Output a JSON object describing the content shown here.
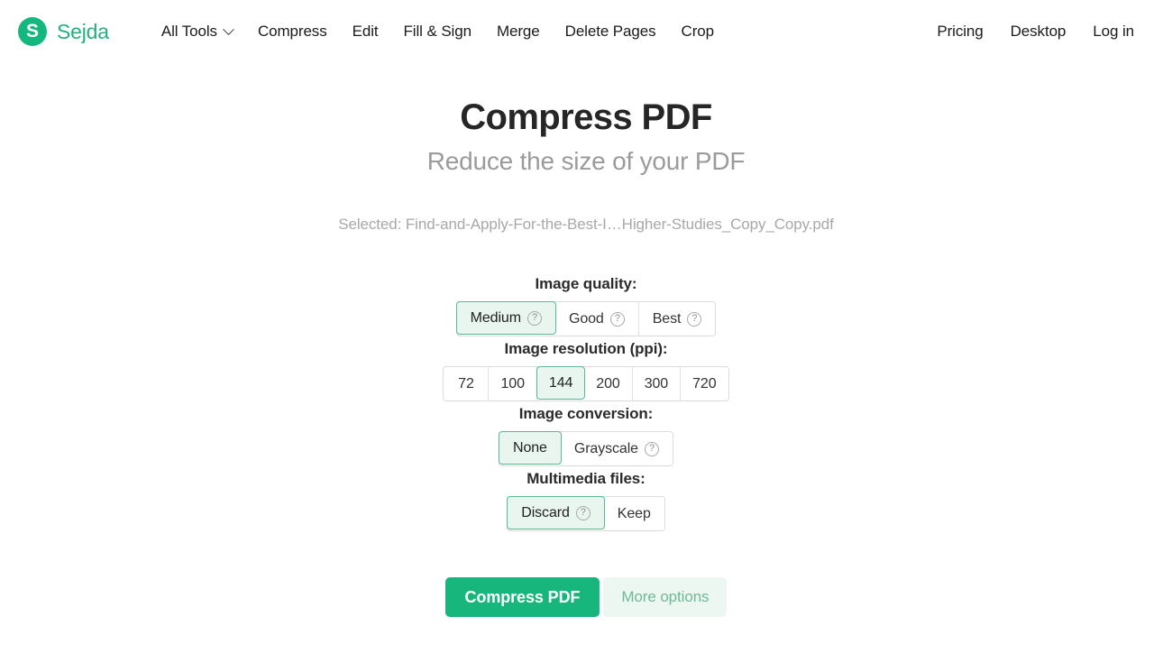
{
  "brand": {
    "mark_letter": "S",
    "name": "Sejda"
  },
  "nav": {
    "left": [
      {
        "label": "All Tools",
        "has_caret": true
      },
      {
        "label": "Compress",
        "has_caret": false
      },
      {
        "label": "Edit",
        "has_caret": false
      },
      {
        "label": "Fill & Sign",
        "has_caret": false
      },
      {
        "label": "Merge",
        "has_caret": false
      },
      {
        "label": "Delete Pages",
        "has_caret": false
      },
      {
        "label": "Crop",
        "has_caret": false
      }
    ],
    "right": [
      {
        "label": "Pricing"
      },
      {
        "label": "Desktop"
      },
      {
        "label": "Log in"
      }
    ]
  },
  "main": {
    "title": "Compress PDF",
    "subtitle": "Reduce the size of your PDF",
    "selected_file": "Selected: Find-and-Apply-For-the-Best-I…Higher-Studies_Copy_Copy.pdf"
  },
  "options": [
    {
      "key": "image_quality",
      "label": "Image quality:",
      "choices": [
        {
          "label": "Medium",
          "selected": true,
          "help": true
        },
        {
          "label": "Good",
          "selected": false,
          "help": true
        },
        {
          "label": "Best",
          "selected": false,
          "help": true
        }
      ]
    },
    {
      "key": "image_resolution",
      "label": "Image resolution (ppi):",
      "choices": [
        {
          "label": "72",
          "selected": false,
          "help": false
        },
        {
          "label": "100",
          "selected": false,
          "help": false
        },
        {
          "label": "144",
          "selected": true,
          "help": false
        },
        {
          "label": "200",
          "selected": false,
          "help": false
        },
        {
          "label": "300",
          "selected": false,
          "help": false
        },
        {
          "label": "720",
          "selected": false,
          "help": false
        }
      ]
    },
    {
      "key": "image_conversion",
      "label": "Image conversion:",
      "choices": [
        {
          "label": "None",
          "selected": true,
          "help": false
        },
        {
          "label": "Grayscale",
          "selected": false,
          "help": true
        }
      ]
    },
    {
      "key": "multimedia_files",
      "label": "Multimedia files:",
      "choices": [
        {
          "label": "Discard",
          "selected": true,
          "help": true
        },
        {
          "label": "Keep",
          "selected": false,
          "help": false
        }
      ]
    }
  ],
  "actions": {
    "primary_label": "Compress PDF",
    "secondary_label": "More options"
  },
  "icons": {
    "help": "?",
    "chevron_down": "chevron-down-icon"
  },
  "colors": {
    "brand_green": "#14b87e",
    "primary_button": "#17b67d",
    "selected_border": "#5cb894",
    "selected_bg": "#e9f5ef",
    "secondary_bg": "#edf7f2",
    "secondary_text": "#6fb99a",
    "title": "#262626",
    "subtitle": "#9b9b9b",
    "muted": "#a8a8a8"
  }
}
